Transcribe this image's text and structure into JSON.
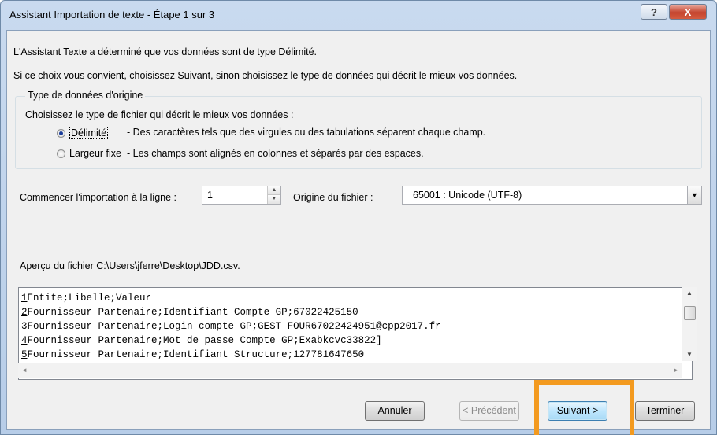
{
  "window": {
    "title": "Assistant Importation de texte - Étape 1 sur 3",
    "help_label": "?",
    "close_label": "X"
  },
  "intro": {
    "line1": "L'Assistant Texte a déterminé que vos données sont de type Délimité.",
    "line2": "Si ce choix vous convient, choisissez Suivant, sinon choisissez le type de données qui décrit le mieux vos données."
  },
  "data_type_group": {
    "legend": "Type de données d'origine",
    "prompt": "Choisissez le type de fichier qui décrit le mieux vos données :",
    "options": [
      {
        "label": "Délimité",
        "description": "- Des caractères tels que des virgules ou des tabulations séparent chaque champ.",
        "selected": true
      },
      {
        "label": "Largeur fixe",
        "description": "- Les champs sont alignés en colonnes et séparés par des espaces.",
        "selected": false
      }
    ]
  },
  "start_row": {
    "label": "Commencer l'importation à la ligne :",
    "value": "1"
  },
  "file_origin": {
    "label": "Origine du fichier :",
    "value": "65001 : Unicode (UTF-8)"
  },
  "preview": {
    "label": "Aperçu du fichier C:\\Users\\jferre\\Desktop\\JDD.csv.",
    "lines": [
      {
        "num": "1",
        "text": "Entite;Libelle;Valeur"
      },
      {
        "num": "2",
        "text": "Fournisseur Partenaire;Identifiant Compte GP;67022425150"
      },
      {
        "num": "3",
        "text": "Fournisseur Partenaire;Login compte GP;GEST_FOUR67022424951@cpp2017.fr"
      },
      {
        "num": "4",
        "text": "Fournisseur Partenaire;Mot de passe Compte GP;Exabkcvc33822]"
      },
      {
        "num": "5",
        "text": "Fournisseur Partenaire;Identifiant Structure;127781647650"
      }
    ]
  },
  "buttons": {
    "cancel": "Annuler",
    "previous": "< Précédent",
    "next": "Suivant >",
    "finish": "Terminer"
  },
  "colors": {
    "highlight": "#f39a1f",
    "default_button": "#bee6fd"
  }
}
